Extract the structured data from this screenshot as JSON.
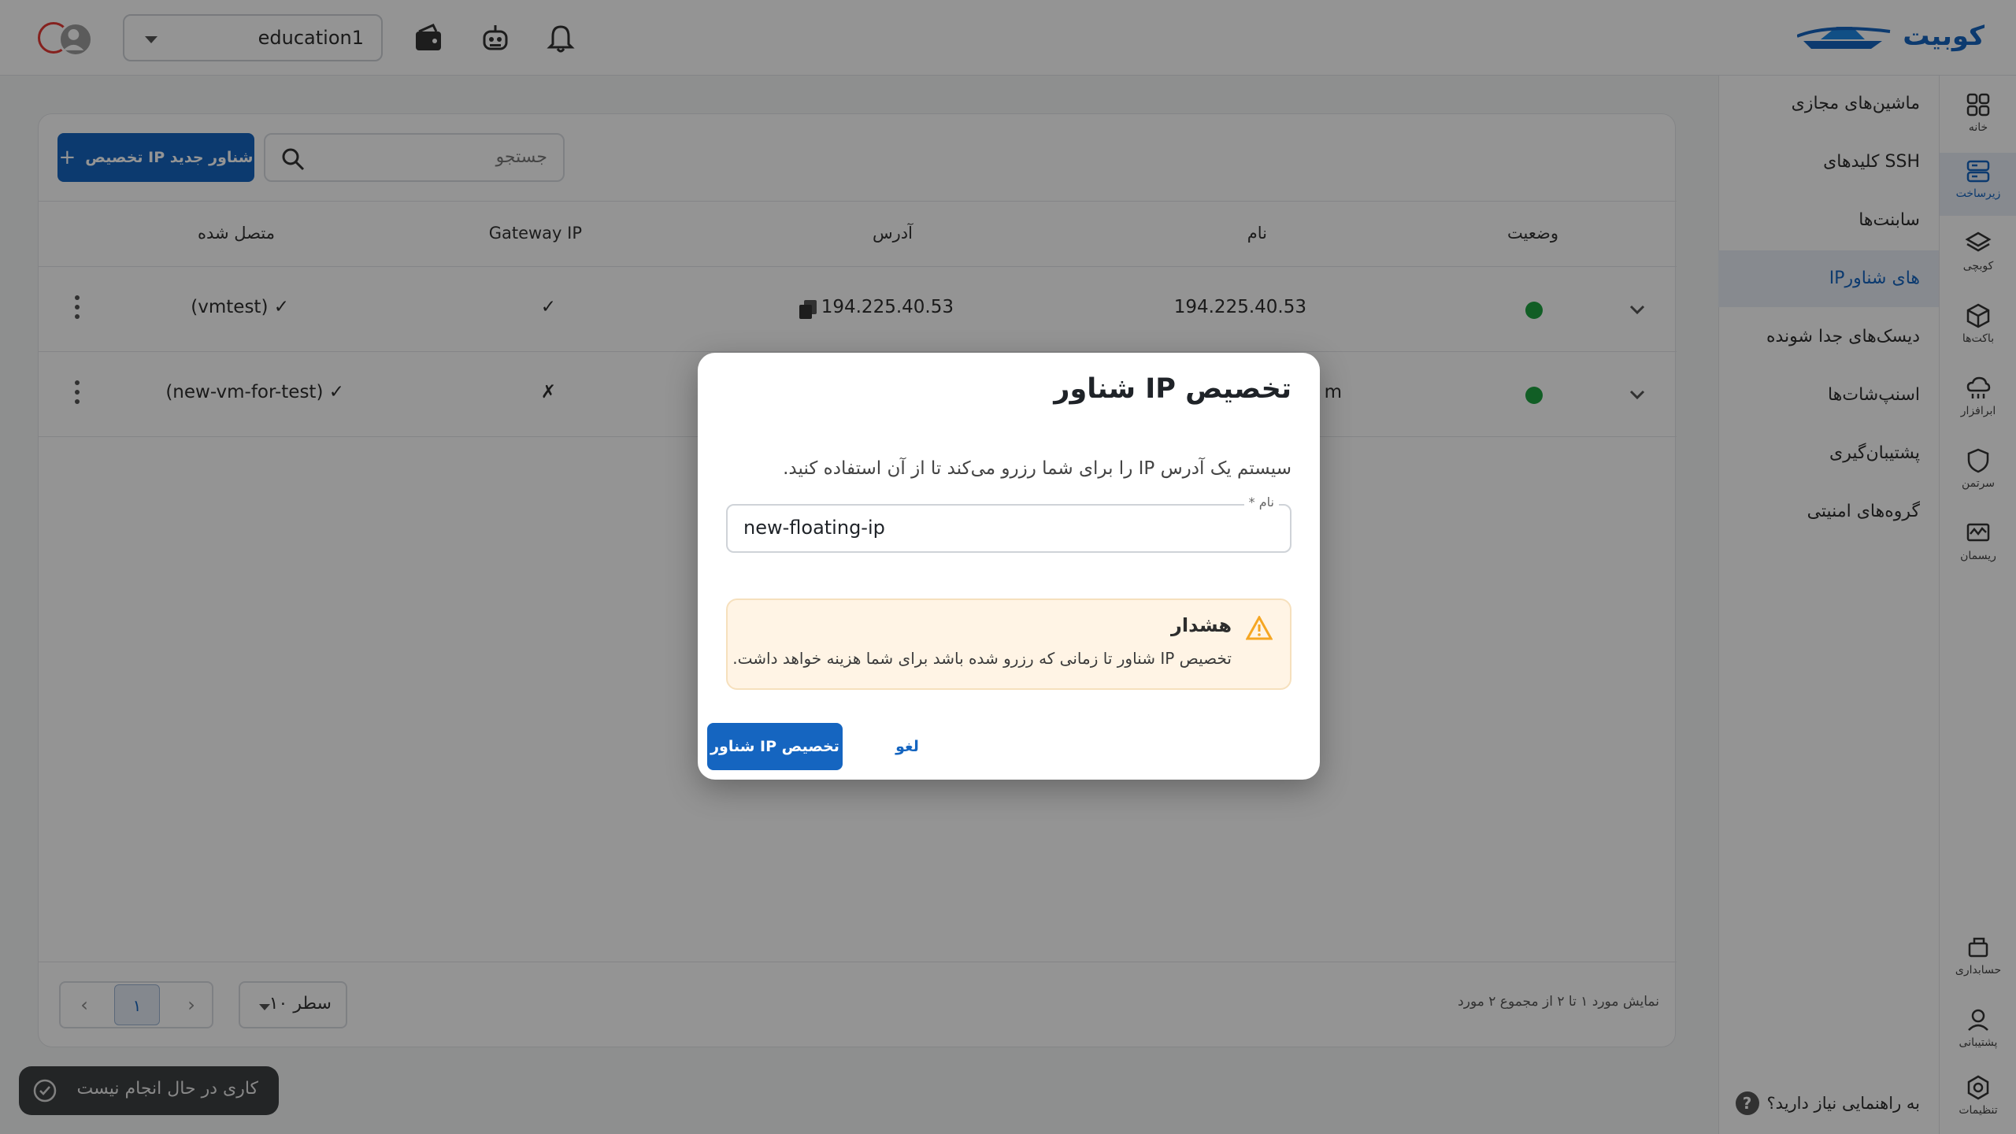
{
  "brand": {
    "name": "کوبیت"
  },
  "topbar": {
    "project": "education1"
  },
  "rail": [
    {
      "label": "خانه",
      "icon": "grid-icon"
    },
    {
      "label": "زیرساخت",
      "icon": "server-icon"
    },
    {
      "label": "کوبچی",
      "icon": "layers-icon"
    },
    {
      "label": "باکت‌ها",
      "icon": "box-icon"
    },
    {
      "label": "ابرافزار",
      "icon": "cloud-app-icon"
    },
    {
      "label": "سرتمن",
      "icon": "shield-icon"
    },
    {
      "label": "ریسمان",
      "icon": "monitor-icon"
    },
    {
      "label": "حسابداری",
      "icon": "accounting-icon"
    },
    {
      "label": "پشتیبانی",
      "icon": "support-icon"
    },
    {
      "label": "تنظیمات",
      "icon": "settings-icon"
    }
  ],
  "submenu": {
    "items": [
      "ماشین‌های مجازی",
      "کلیدهای SSH",
      "سابنت‌ها",
      "IPهای شناور",
      "دیسک‌های جدا شونده",
      "اسنپ‌شات‌ها",
      "پشتیبان‌گیری",
      "گروه‌های امنیتی"
    ],
    "help": "به راهنمایی نیاز دارید؟"
  },
  "toolbar": {
    "add_label": "تخصیص IP شناور جدید",
    "search_placeholder": "جستجو"
  },
  "table": {
    "headers": {
      "status": "وضعیت",
      "name": "نام",
      "address": "آدرس",
      "gateway": "Gateway IP",
      "connected": "متصل شده"
    },
    "rows": [
      {
        "name": "194.225.40.53",
        "address": "194.225.40.53",
        "gateway": "✓",
        "connected": "(vmtest) ✓"
      },
      {
        "name": "m",
        "address": "",
        "gateway": "✗",
        "connected": "(new-vm-for-test) ✓"
      }
    ]
  },
  "footer": {
    "rows_per_page": "۱۰ سطر",
    "current_page": "۱",
    "showing": "نمایش مورد ۱ تا ۲ از مجموع ۲ مورد"
  },
  "toast": {
    "text": "کاری در حال انجام نیست"
  },
  "modal": {
    "title": "تخصیص IP شناور",
    "description": "سیستم یک آدرس IP را برای شما رزرو می‌کند تا از آن استفاده کنید.",
    "field_label": "نام *",
    "field_value": "new-floating-ip",
    "warning_title": "هشدار",
    "warning_text": "تخصیص IP شناور تا زمانی که رزرو شده باشد برای شما هزینه خواهد داشت.",
    "confirm": "تخصیص IP شناور",
    "cancel": "لغو"
  },
  "colors": {
    "primary": "#1565c0",
    "status_active": "#1ea341",
    "warning_bg": "#fff4e5"
  }
}
